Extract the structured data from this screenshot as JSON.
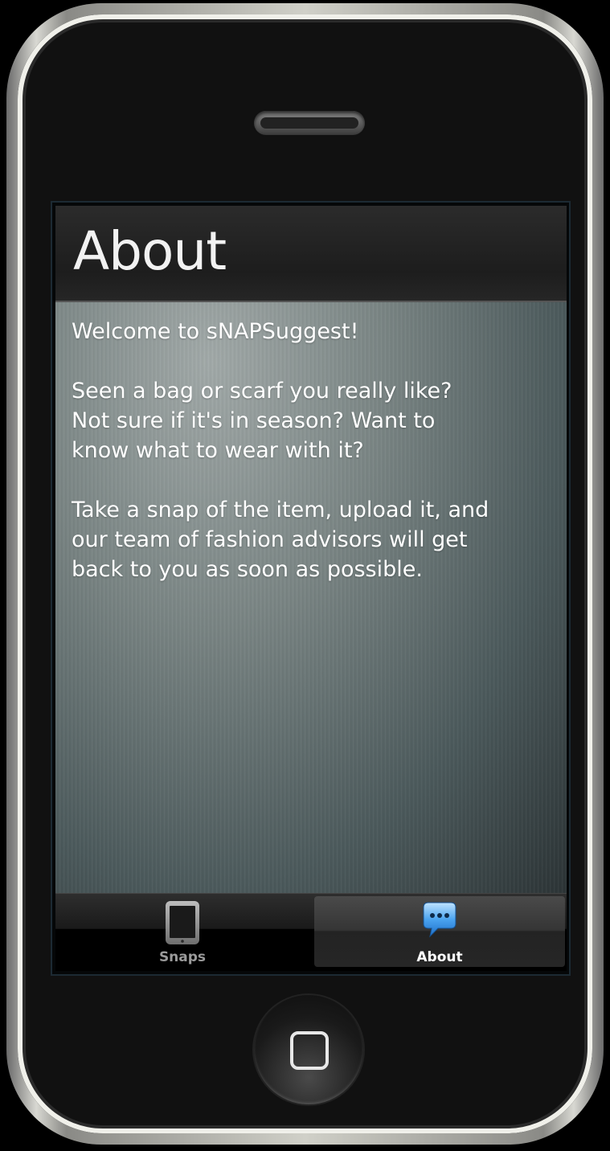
{
  "screen": {
    "title": "About",
    "paragraphs": [
      "Welcome to sNAPSuggest!",
      "Seen a bag or scarf you really like?\nNot sure if it's in season? Want to\nknow what to wear with it?",
      "Take a snap of the item, upload it, and\nour team of fashion advisors will get\nback to you as soon as possible."
    ]
  },
  "tabbar": {
    "tabs": [
      {
        "label": "Snaps",
        "icon": "device-icon",
        "selected": false
      },
      {
        "label": "About",
        "icon": "speech-bubble-icon",
        "selected": true
      }
    ]
  },
  "colors": {
    "accent_icon": "#3a8fe0",
    "title_bar": "#1e1e1e",
    "text": "#ffffff"
  }
}
